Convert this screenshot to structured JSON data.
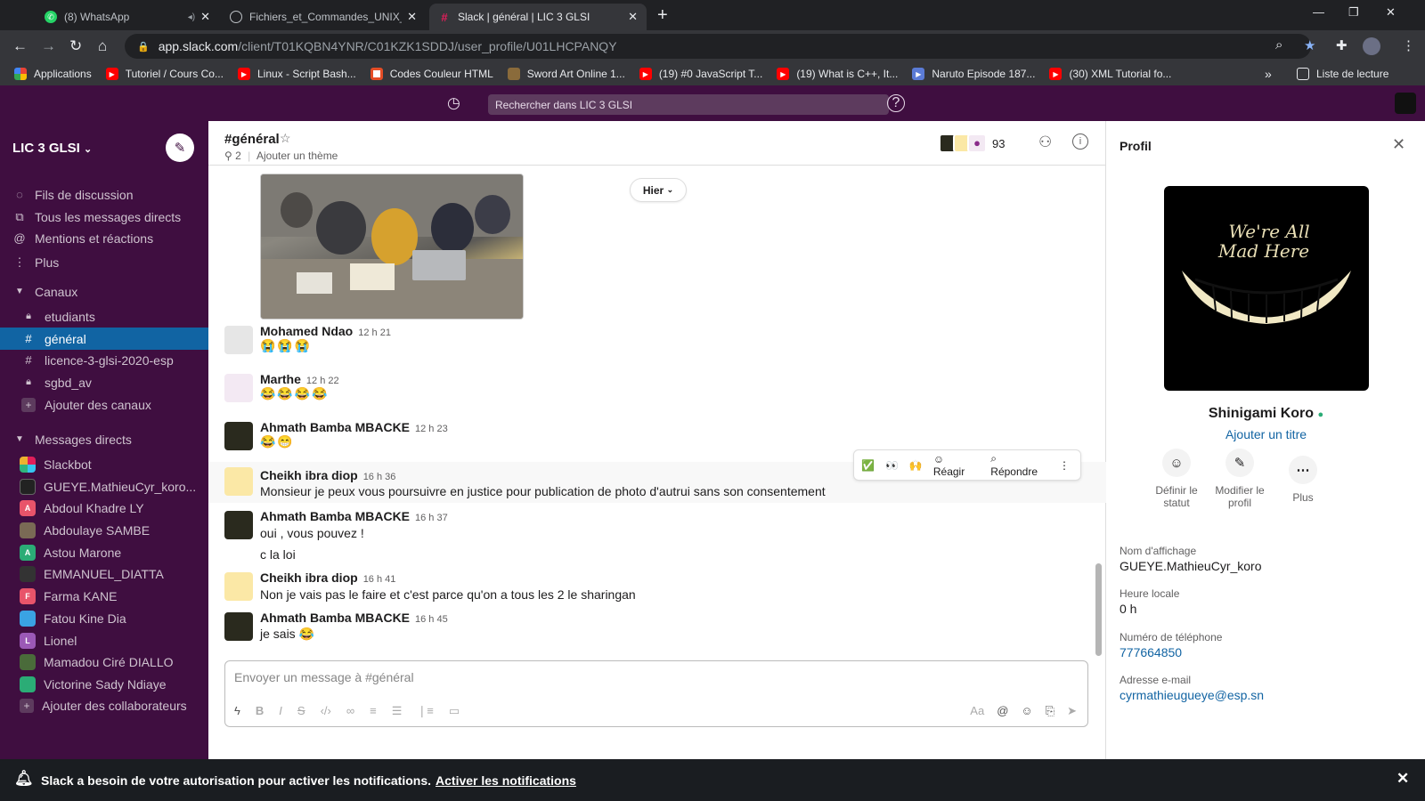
{
  "browser": {
    "tabs": [
      {
        "title": "(8) WhatsApp",
        "favicon": "whatsapp-icon",
        "color": "#25d366"
      },
      {
        "title": "Fichiers_et_Commandes_UNIX_d",
        "favicon": "globe-icon",
        "color": "#9aa0a6"
      },
      {
        "title": "Slack | général | LIC 3 GLSI",
        "favicon": "slack-icon",
        "color": "#e01e5a"
      }
    ],
    "url_host": "app.slack.com",
    "url_path": "/client/T01KQBN4YNR/C01KZK1SDDJ/user_profile/U01LHCPANQY",
    "bookmarks": [
      {
        "label": "Applications",
        "icon": "apps-grid-icon",
        "color": "#4285f4"
      },
      {
        "label": "Tutoriel / Cours Co...",
        "icon": "youtube-icon",
        "color": "#ff0000"
      },
      {
        "label": "Linux - Script Bash...",
        "icon": "youtube-icon",
        "color": "#ff0000"
      },
      {
        "label": "Codes Couleur HTML",
        "icon": "bookmark-icon",
        "color": "#e8eaed"
      },
      {
        "label": "Sword Art Online 1...",
        "icon": "bookmark-icon",
        "color": "#8a6b3b"
      },
      {
        "label": "(19) #0 JavaScript T...",
        "icon": "youtube-icon",
        "color": "#ff0000"
      },
      {
        "label": "(19) What is C++, It...",
        "icon": "youtube-icon",
        "color": "#ff0000"
      },
      {
        "label": "Naruto Episode 187...",
        "icon": "bookmark-icon",
        "color": "#5b7bd6"
      },
      {
        "label": "(30) XML Tutorial fo...",
        "icon": "youtube-icon",
        "color": "#ff0000"
      }
    ],
    "reading_list": "Liste de lecture"
  },
  "slack": {
    "search_placeholder": "Rechercher dans LIC 3 GLSI",
    "workspace": "LIC 3 GLSI",
    "nav": [
      {
        "label": "Fils de discussion",
        "icon": "threads-icon"
      },
      {
        "label": "Tous les messages directs",
        "icon": "dm-icon"
      },
      {
        "label": "Mentions et réactions",
        "icon": "at-icon"
      },
      {
        "label": "Plus",
        "icon": "more-vertical-icon"
      }
    ],
    "channels_header": "Canaux",
    "channels": [
      {
        "label": "etudiants",
        "icon": "lock-icon"
      },
      {
        "label": "général",
        "icon": "hash-icon"
      },
      {
        "label": "licence-3-glsi-2020-esp",
        "icon": "hash-icon"
      },
      {
        "label": "sgbd_av",
        "icon": "lock-icon"
      }
    ],
    "add_channels": "Ajouter des canaux",
    "dm_header": "Messages directs",
    "dms": [
      {
        "label": "Slackbot",
        "initial": "S",
        "color": "#2eb67d"
      },
      {
        "label": "GUEYE.MathieuCyr_koro...",
        "initial": "G",
        "color": "#222"
      },
      {
        "label": "Abdoul Khadre LY",
        "initial": "A",
        "color": "#e8546a"
      },
      {
        "label": "Abdoulaye SAMBE",
        "initial": "A",
        "color": "#7a6a55"
      },
      {
        "label": "Astou Marone",
        "initial": "A",
        "color": "#2bac76"
      },
      {
        "label": "EMMANUEL_DIATTA",
        "initial": "E",
        "color": "#333"
      },
      {
        "label": "Farma KANE",
        "initial": "F",
        "color": "#e8546a"
      },
      {
        "label": "Fatou Kine Dia",
        "initial": "F",
        "color": "#3aa3e3"
      },
      {
        "label": "Lionel",
        "initial": "L",
        "color": "#9b59b6"
      },
      {
        "label": "Mamadou Ciré DIALLO",
        "initial": "M",
        "color": "#4a6b3a"
      },
      {
        "label": "Victorine Sady Ndiaye",
        "initial": "V",
        "color": "#2bac76"
      }
    ],
    "add_collaborators": "Ajouter des collaborateurs",
    "channel": {
      "name": "#général",
      "pins": "2",
      "topic": "Ajouter un thème",
      "member_count": "93",
      "date_divider": "Hier"
    },
    "messages": [
      {
        "author": "Mohamed Ndao",
        "time": "12 h 21",
        "text": "😭😭😭",
        "emoji": true,
        "avatar": "#ddd"
      },
      {
        "author": "Marthe",
        "time": "12 h 22",
        "text": "😂😂😂😂",
        "emoji": true,
        "avatar": "#f3e9f3"
      },
      {
        "author": "Ahmath Bamba MBACKE",
        "time": "12 h 23",
        "text": "😂😁",
        "emoji": true,
        "avatar": "#2a2a1e"
      },
      {
        "author": "Cheikh ibra diop",
        "time": "16 h 36",
        "text": "Monsieur je peux vous poursuivre en justice pour publication de photo d'autrui sans son consentement",
        "emoji": false,
        "avatar": "#fbe8a6"
      },
      {
        "author": "Ahmath Bamba MBACKE",
        "time": "16 h 37",
        "text": "oui , vous pouvez !",
        "emoji": false,
        "avatar": "#2a2a1e"
      },
      {
        "author": "",
        "time": "",
        "text": "c la loi",
        "emoji": false,
        "avatar": ""
      },
      {
        "author": "Cheikh ibra diop",
        "time": "16 h 41",
        "text": "Non je vais pas le faire et c'est parce qu'on a tous les 2 le sharingan",
        "emoji": false,
        "avatar": "#fbe8a6"
      },
      {
        "author": "Ahmath Bamba MBACKE",
        "time": "16 h 45",
        "text": "je sais 😂",
        "emoji": false,
        "avatar": "#2a2a1e"
      }
    ],
    "hover_actions": {
      "react": "Réagir",
      "reply": "Répondre"
    },
    "composer_placeholder": "Envoyer un message à #général",
    "profile": {
      "panel_title": "Profil",
      "name": "Shinigami Koro",
      "add_title": "Ajouter un titre",
      "image_text_1": "We're All",
      "image_text_2": "Mad Here",
      "actions": [
        {
          "label": "Définir le statut",
          "icon": "smiley-icon"
        },
        {
          "label": "Modifier le profil",
          "icon": "pencil-icon"
        },
        {
          "label": "Plus",
          "icon": "more-horizontal-icon"
        }
      ],
      "display_name_label": "Nom d'affichage",
      "display_name": "GUEYE.MathieuCyr_koro",
      "local_time_label": "Heure locale",
      "local_time": "0 h",
      "phone_label": "Numéro de téléphone",
      "phone": "777664850",
      "email_label": "Adresse e-mail",
      "email": "cyrmathieugueye@esp.sn"
    },
    "notification": {
      "text": "Slack a besoin de votre autorisation pour activer les notifications.",
      "link": "Activer les notifications"
    }
  }
}
